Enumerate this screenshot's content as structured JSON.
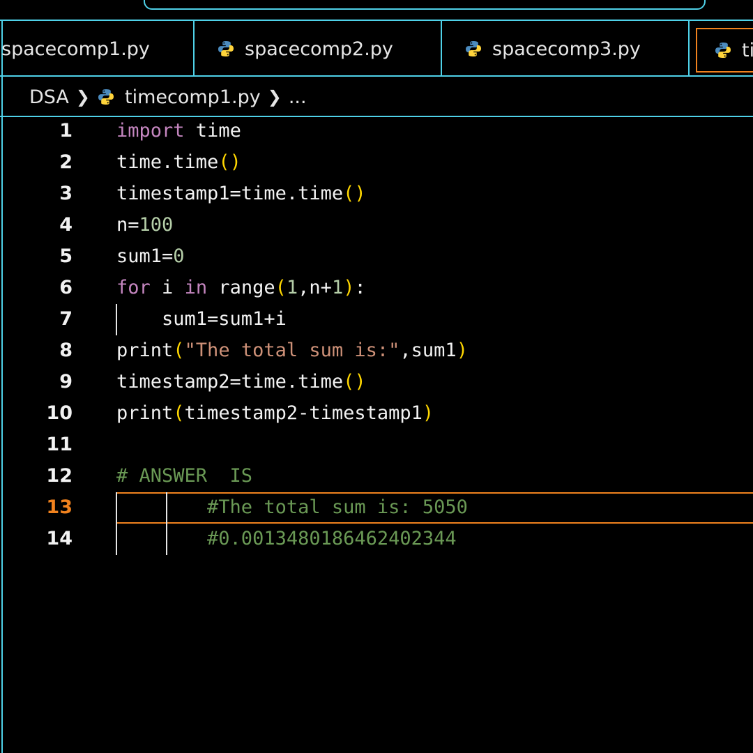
{
  "tabs": [
    {
      "label": "spacecomp1.py"
    },
    {
      "label": "spacecomp2.py"
    },
    {
      "label": "spacecomp3.py"
    },
    {
      "label": "ti"
    }
  ],
  "breadcrumb": {
    "folder": "DSA",
    "file": "timecomp1.py",
    "more": "..."
  },
  "editor": {
    "active_line": 13,
    "lines": [
      {
        "no": "1"
      },
      {
        "no": "2"
      },
      {
        "no": "3"
      },
      {
        "no": "4"
      },
      {
        "no": "5"
      },
      {
        "no": "6"
      },
      {
        "no": "7"
      },
      {
        "no": "8"
      },
      {
        "no": "9"
      },
      {
        "no": "10"
      },
      {
        "no": "11"
      },
      {
        "no": "12"
      },
      {
        "no": "13"
      },
      {
        "no": "14"
      }
    ],
    "tokens": {
      "l1": [
        "import",
        " time"
      ],
      "l2": [
        "time.time",
        "()"
      ],
      "l3": [
        "timestamp1=time.time",
        "()"
      ],
      "l4": [
        "n=",
        "100"
      ],
      "l5": [
        "sum1=",
        "0"
      ],
      "l6": [
        "for",
        " i ",
        "in",
        " range",
        "(",
        "1",
        ",n+",
        "1",
        ")",
        ":"
      ],
      "l7": [
        "    sum1=sum1+i"
      ],
      "l8": [
        "print",
        "(",
        "\"The total sum is:\"",
        ",sum1",
        ")"
      ],
      "l9": [
        "timestamp2=time.time",
        "()"
      ],
      "l10": [
        "print",
        "(",
        "timestamp2-timestamp1",
        ")"
      ],
      "l12": [
        "# ANSWER  IS"
      ],
      "l13": [
        "        #The total sum is: 5050"
      ],
      "l14": [
        "        #0.0013480186462402344"
      ]
    }
  },
  "colors": {
    "accent_border": "#4fd1e8",
    "active_tab_border": "#f0821e",
    "keyword": "#c586c0",
    "number": "#b5cea8",
    "string": "#ce9178",
    "bracket": "#ffd700",
    "comment": "#6a9955"
  },
  "icons": {
    "file": "python-icon",
    "chevron": "chevron-right-icon"
  }
}
